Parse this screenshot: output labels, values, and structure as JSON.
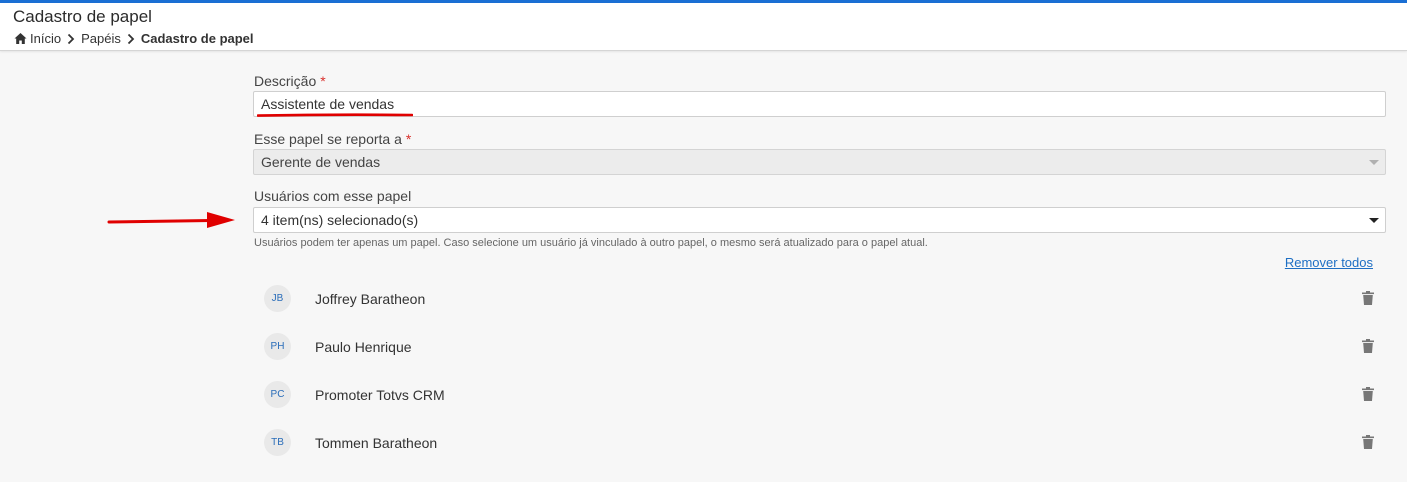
{
  "header": {
    "title": "Cadastro de papel",
    "breadcrumb": [
      "Início",
      "Papéis",
      "Cadastro de papel"
    ]
  },
  "form": {
    "description": {
      "label": "Descrição",
      "required_mark": "*",
      "value": "Assistente de vendas"
    },
    "reports_to": {
      "label": "Esse papel se reporta a",
      "required_mark": "*",
      "value": "Gerente de vendas",
      "disabled": true
    },
    "users": {
      "label": "Usuários com esse papel",
      "value": "4 item(ns) selecionado(s)",
      "help": "Usuários podem ter apenas um papel. Caso selecione um usuário já vinculado à outro papel, o mesmo será atualizado para o papel atual.",
      "remove_all": "Remover todos"
    }
  },
  "users": [
    {
      "initials": "JB",
      "name": "Joffrey Baratheon"
    },
    {
      "initials": "PH",
      "name": "Paulo Henrique"
    },
    {
      "initials": "PC",
      "name": "Promoter Totvs CRM"
    },
    {
      "initials": "TB",
      "name": "Tommen Baratheon"
    }
  ],
  "colors": {
    "accent": "#1a6fd4",
    "link": "#1e6fc4",
    "required": "#d9302c",
    "annotation": "#e00000"
  },
  "icons": {
    "home": "home-icon",
    "chevron": "chevron-right-icon",
    "dropdown": "chevron-down-icon",
    "delete": "trash-icon"
  }
}
